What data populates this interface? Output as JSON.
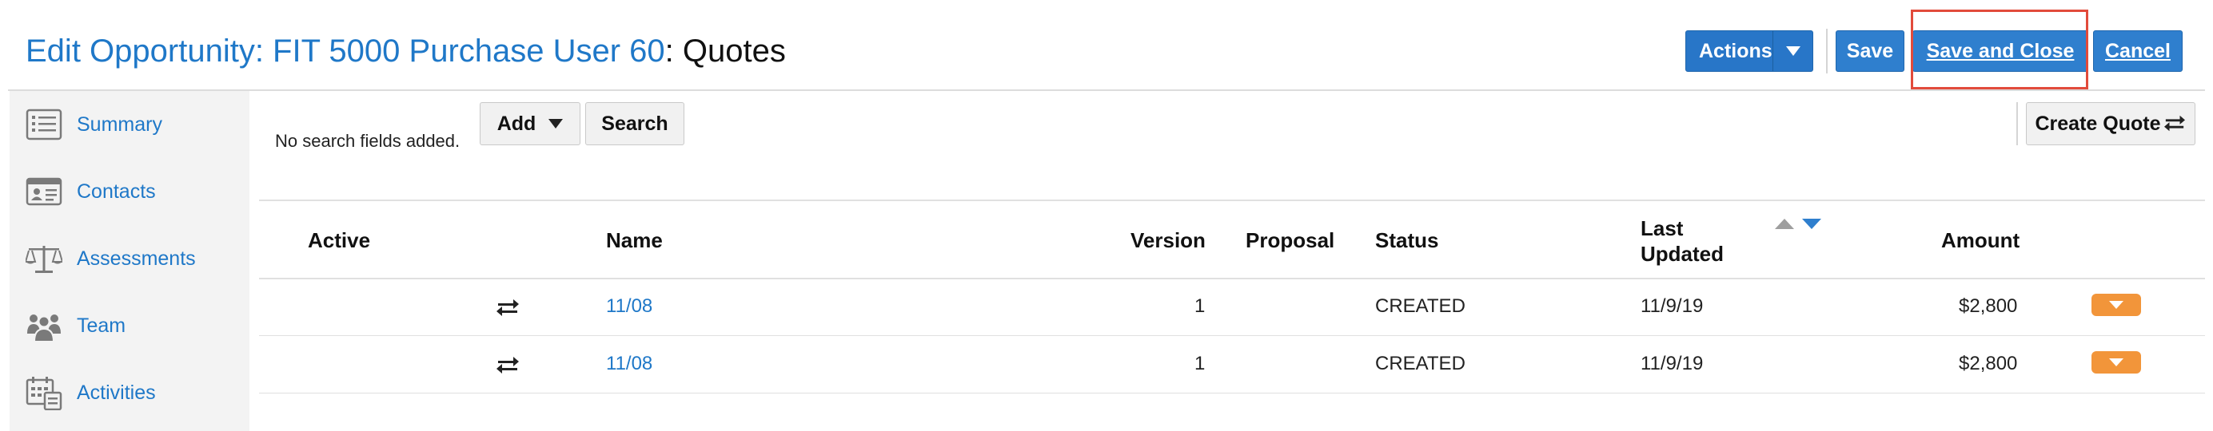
{
  "header": {
    "title_link": "Edit Opportunity: FIT 5000 Purchase User 60",
    "title_rest": ": Quotes",
    "actions_label": "Actions",
    "save_label": "Save",
    "save_close_label": "Save and Close",
    "cancel_label": "Cancel"
  },
  "sidebar": {
    "items": [
      {
        "label": "Summary",
        "icon": "summary-list-icon"
      },
      {
        "label": "Contacts",
        "icon": "contact-card-icon"
      },
      {
        "label": "Assessments",
        "icon": "scale-icon"
      },
      {
        "label": "Team",
        "icon": "team-icon"
      },
      {
        "label": "Activities",
        "icon": "calendar-icon"
      }
    ]
  },
  "toolbar": {
    "search_status": "No search fields added.",
    "add_label": "Add",
    "search_label": "Search",
    "create_quote_label": "Create Quote"
  },
  "table": {
    "columns": [
      "Active",
      "Name",
      "Version",
      "Proposal",
      "Status",
      "Last Updated",
      "Amount"
    ],
    "last_updated_line1": "Last",
    "last_updated_line2": "Updated",
    "rows": [
      {
        "name": "11/08",
        "version": "1",
        "proposal": "",
        "status": "CREATED",
        "last_updated": "11/9/19",
        "amount": "$2,800"
      },
      {
        "name": "11/08",
        "version": "1",
        "proposal": "",
        "status": "CREATED",
        "last_updated": "11/9/19",
        "amount": "$2,800"
      }
    ]
  },
  "colors": {
    "link": "#1f78c8",
    "primary_button": "#2f7fce",
    "highlight": "#e24b3b",
    "row_menu": "#f2953a"
  }
}
